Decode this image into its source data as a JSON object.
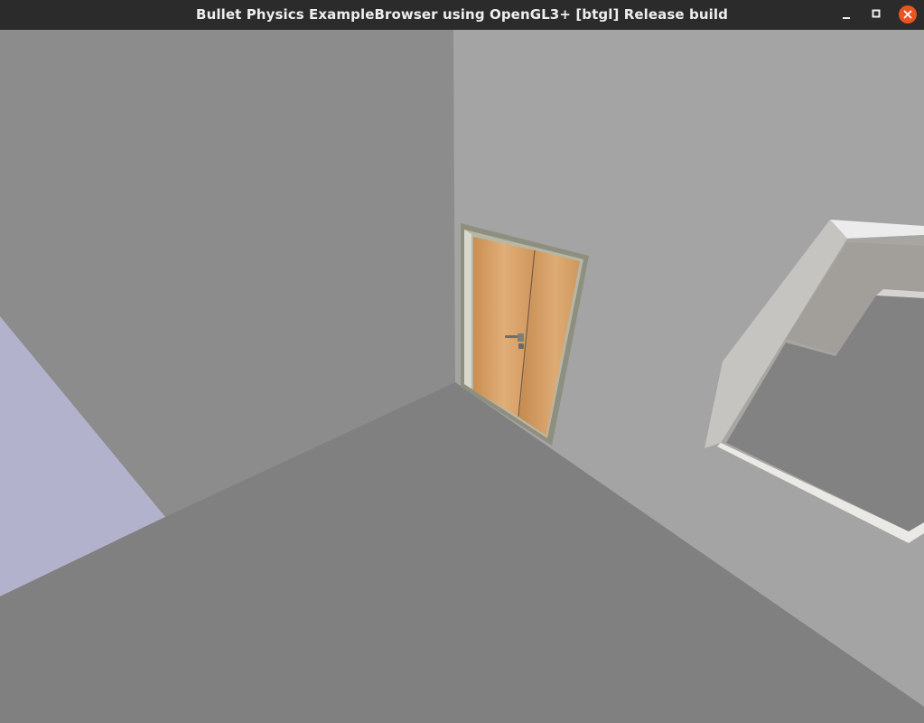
{
  "window": {
    "title": "Bullet Physics ExampleBrowser using OpenGL3+ [btgl] Release build",
    "controls": {
      "minimize_icon": "minimize-icon",
      "maximize_icon": "maximize-icon",
      "close_icon": "close-icon"
    }
  },
  "scene": {
    "description_icons": [
      "door-icon",
      "window-opening-icon"
    ],
    "colors": {
      "titlebar": "#2b2b2b",
      "close_button": "#e95420",
      "left_wall": "#8c8c8c",
      "right_wall": "#a4a4a4",
      "floor": "#808080",
      "lavender_panel": "#b2b2cc",
      "door_wood": "#d49a5e",
      "door_frame": "#8f8f80"
    }
  }
}
